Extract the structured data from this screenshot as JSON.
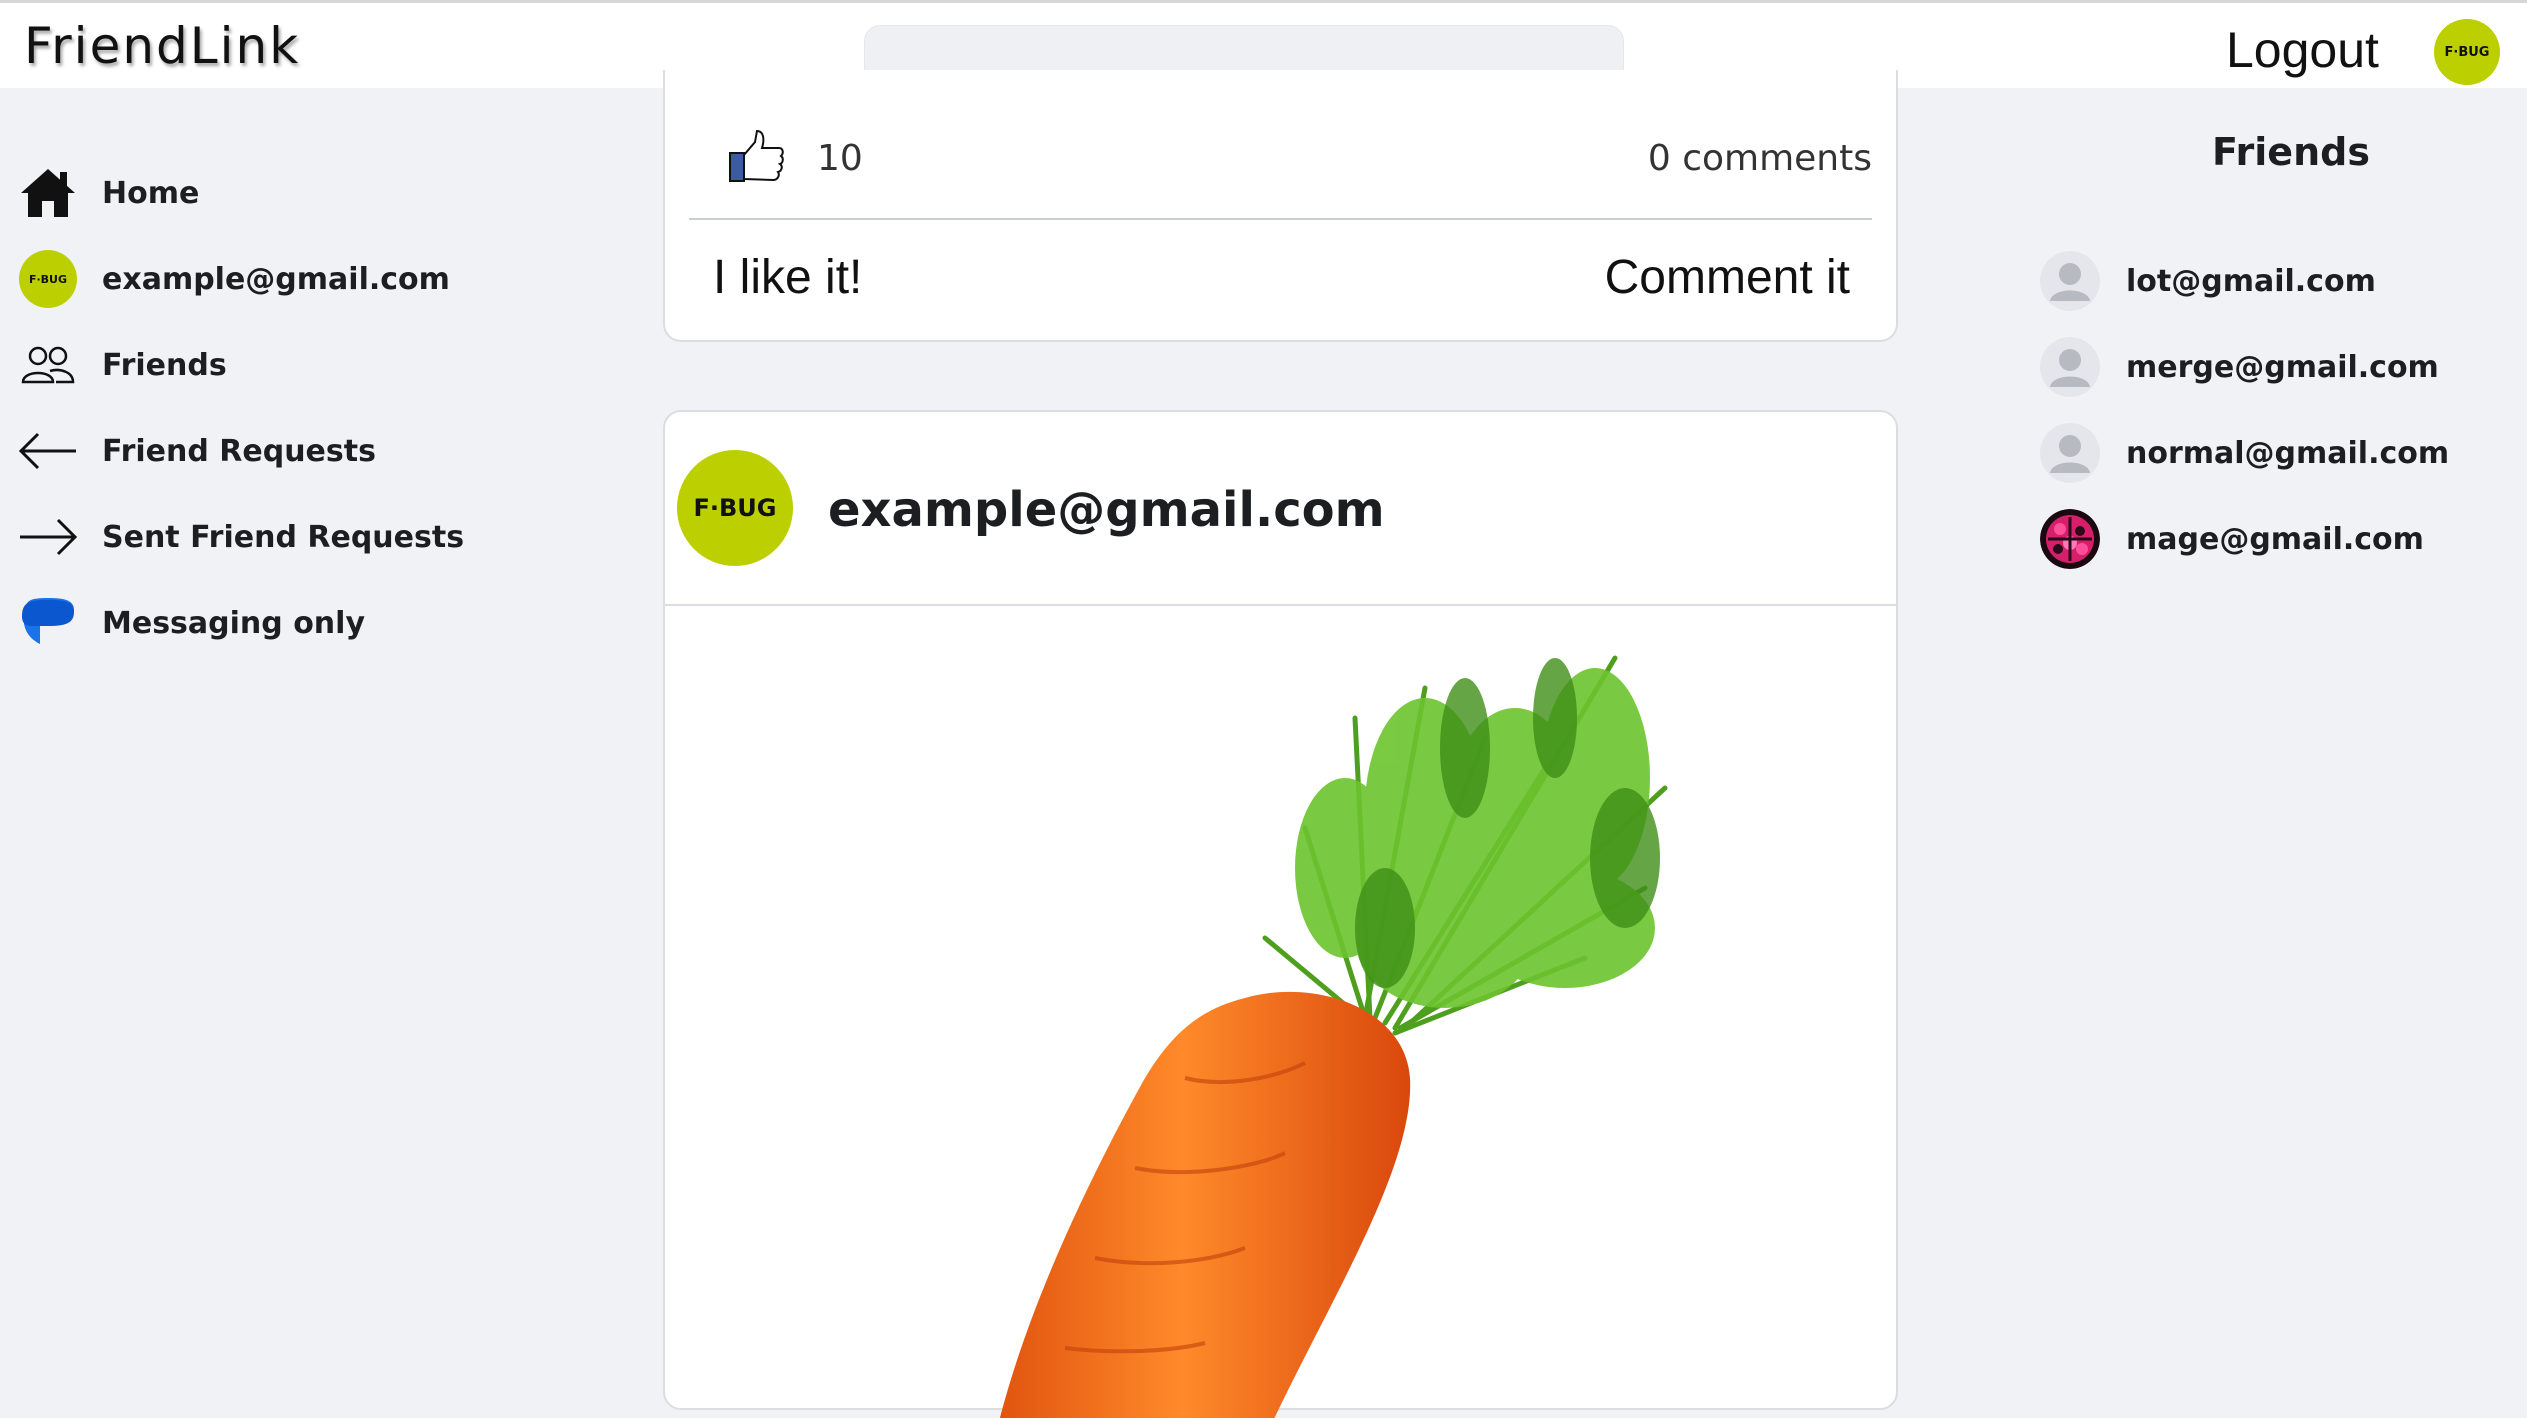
{
  "app": {
    "title": "FriendLink"
  },
  "header": {
    "search_placeholder": "",
    "logout_label": "Logout",
    "avatar_text": "F·BUG"
  },
  "sidebar": {
    "items": [
      {
        "label": "Home",
        "icon": "home-icon"
      },
      {
        "label": "example@gmail.com",
        "icon": "avatar",
        "avatar_text": "F·BUG"
      },
      {
        "label": "Friends",
        "icon": "friends-icon"
      },
      {
        "label": "Friend Requests",
        "icon": "arrow-left-icon"
      },
      {
        "label": "Sent Friend Requests",
        "icon": "arrow-right-icon"
      },
      {
        "label": "Messaging only",
        "icon": "chat-bubble-icon"
      }
    ]
  },
  "feed": {
    "previous_post": {
      "likes": "10",
      "comments": "0 comments",
      "like_action": "I like it!",
      "comment_action": "Comment it"
    },
    "post": {
      "author": "example@gmail.com",
      "avatar_text": "F·BUG",
      "image": "carrot"
    }
  },
  "friends": {
    "title": "Friends",
    "items": [
      {
        "label": "lot@gmail.com",
        "avatar": "default-user"
      },
      {
        "label": "merge@gmail.com",
        "avatar": "default-user"
      },
      {
        "label": "normal@gmail.com",
        "avatar": "default-user"
      },
      {
        "label": "mage@gmail.com",
        "avatar": "pink-pattern"
      }
    ]
  },
  "colors": {
    "brand_avatar": "#bccf00",
    "background": "#f0f2f5",
    "messaging_icon": "#1a73e8"
  }
}
